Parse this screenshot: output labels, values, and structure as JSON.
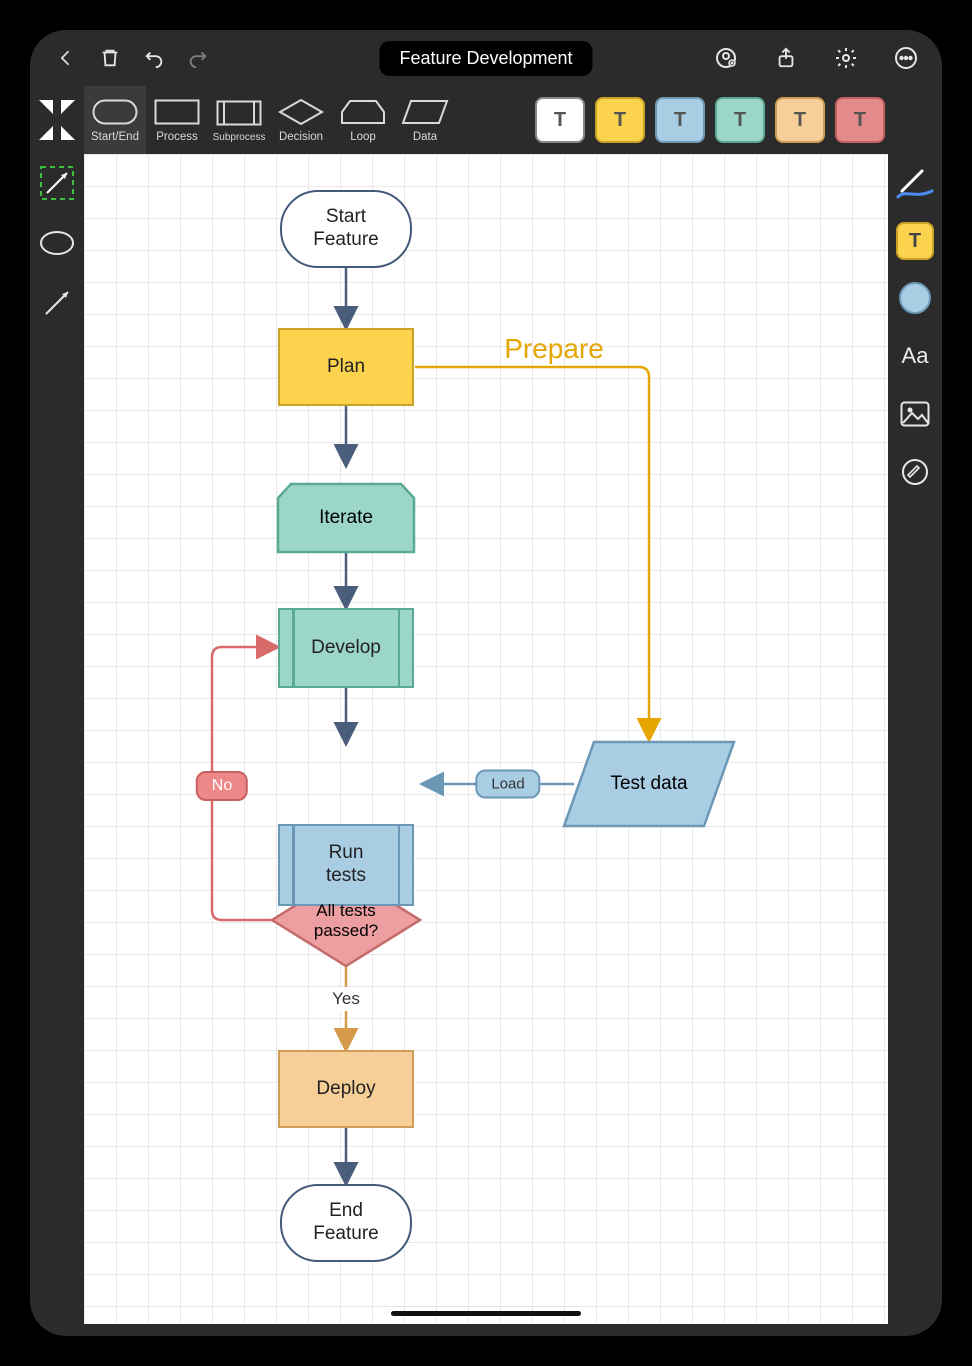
{
  "title": "Feature Development",
  "toolbar": {
    "icons": [
      "back-icon",
      "trash-icon",
      "undo-icon",
      "redo-icon",
      "person-add-icon",
      "share-icon",
      "gear-icon",
      "more-icon"
    ]
  },
  "palette": {
    "shapes": [
      {
        "label": "Start/End",
        "selected": true
      },
      {
        "label": "Process",
        "selected": false
      },
      {
        "label": "Subprocess",
        "selected": false
      },
      {
        "label": "Decision",
        "selected": false
      },
      {
        "label": "Loop",
        "selected": false
      },
      {
        "label": "Data",
        "selected": false
      }
    ],
    "swatches": [
      {
        "letter": "T",
        "bg": "#ffffff",
        "border": "#888"
      },
      {
        "letter": "T",
        "bg": "#fcd34d",
        "border": "#c9a227"
      },
      {
        "letter": "T",
        "bg": "#a9cde3",
        "border": "#6b98b6"
      },
      {
        "letter": "T",
        "bg": "#9cd6c8",
        "border": "#5aa995"
      },
      {
        "letter": "T",
        "bg": "#f5cf97",
        "border": "#ce9b58"
      },
      {
        "letter": "T",
        "bg": "#e48a8a",
        "border": "#c46060"
      }
    ]
  },
  "left_tools": [
    "lasso-arrow-icon",
    "ellipse-shape-icon",
    "line-tool-icon"
  ],
  "right_tools": [
    "pen-icon",
    "text-chip",
    "color-circle",
    "text-style-icon",
    "image-icon",
    "lock-icon"
  ],
  "right_tools_display": {
    "text_chip": "T",
    "text_style": "Aa"
  },
  "flow": {
    "nodes": {
      "start": {
        "text_a": "Start",
        "text_b": "Feature"
      },
      "plan": {
        "text": "Plan"
      },
      "iterate": {
        "text": "Iterate"
      },
      "develop": {
        "text": "Develop"
      },
      "run_tests": {
        "text_a": "Run",
        "text_b": "tests"
      },
      "decision": {
        "text_a": "All tests",
        "text_b": "passed?"
      },
      "deploy": {
        "text": "Deploy"
      },
      "end": {
        "text_a": "End",
        "text_b": "Feature"
      },
      "test_data": {
        "text": "Test data"
      }
    },
    "edge_labels": {
      "prepare": "Prepare",
      "load": "Load",
      "yes": "Yes",
      "no": "No"
    }
  },
  "colors": {
    "arrow": "#4a5d7a",
    "red": "#d96a6a",
    "orange": "#d79a4b",
    "yellow": "#e6a600",
    "blue": "#6b98b6"
  }
}
